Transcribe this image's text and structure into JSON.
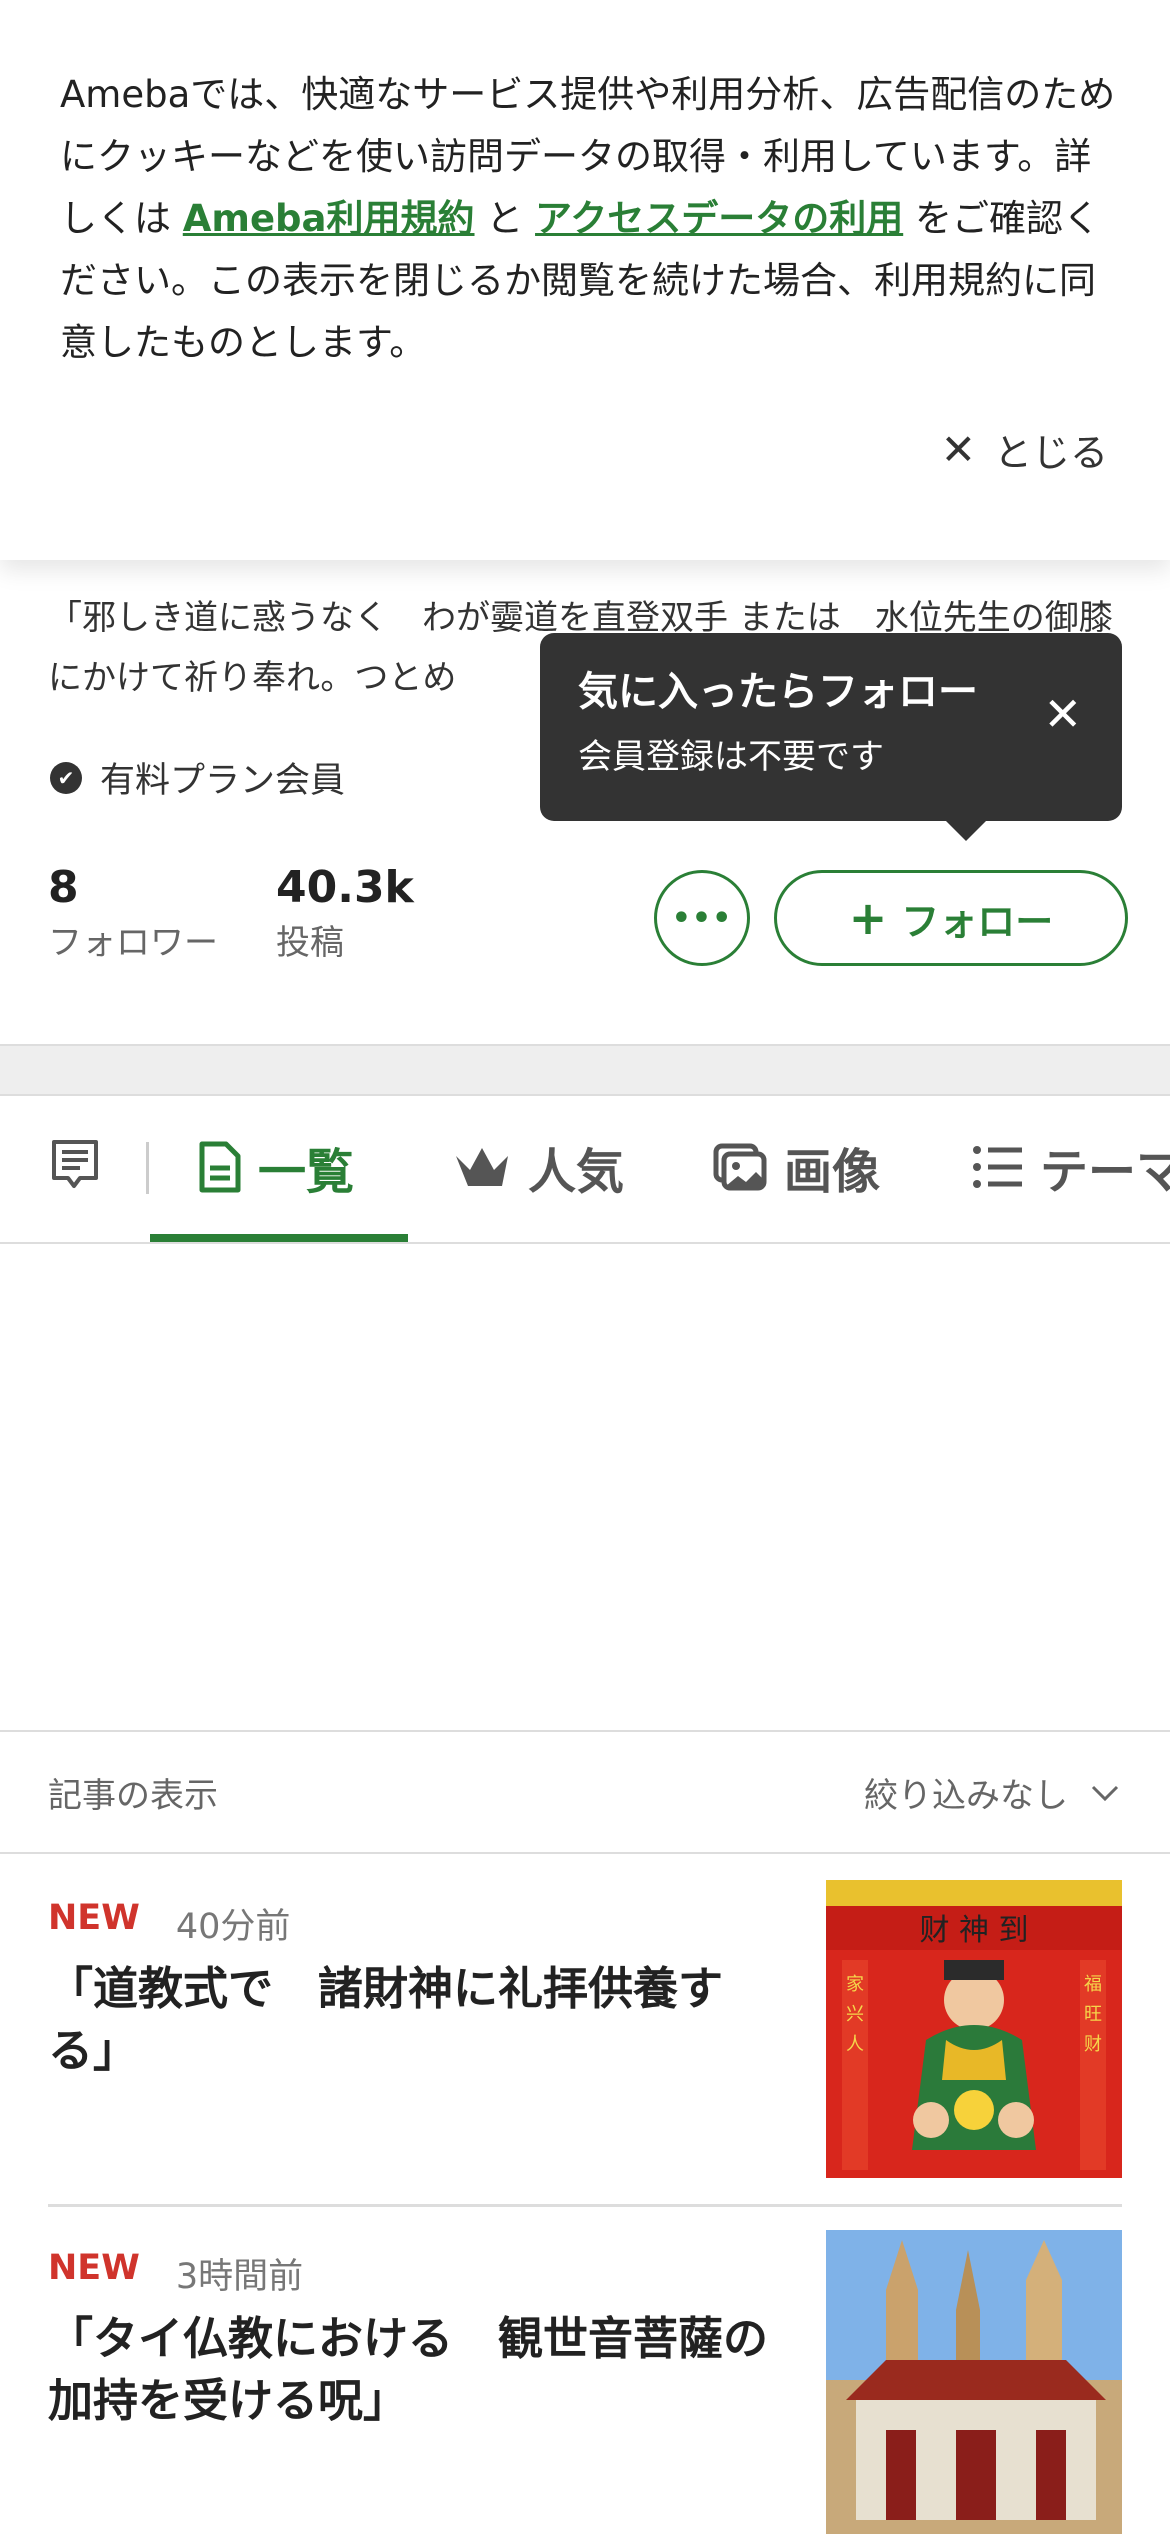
{
  "cookie": {
    "text_1": "Amebaでは、快適なサービス提供や利用分析、広告配信のためにクッキーなどを使い訪問データの取得・利用しています。詳しくは",
    "link_1": "Ameba利用規約",
    "text_2": "と",
    "link_2": "アクセスデータの利用",
    "text_3": "をご確認ください。この表示を閉じるか閲覧を続けた場合、利用規約に同意したものとします。",
    "close_label": "とじる"
  },
  "profile": {
    "description": "「邪しき道に惑うなく　わが孁道を直登双手 または　水位先生の御膝にかけて祈り奉れ。つとめ",
    "badge": "有料プラン会員",
    "followers": {
      "count": "8",
      "label": "フォロワー"
    },
    "posts": {
      "count": "40.3k",
      "label": "投稿"
    },
    "more_label": "•••",
    "follow_label": "フォロー"
  },
  "tooltip": {
    "title": "気に入ったらフォロー",
    "subtitle": "会員登録は不要です"
  },
  "tabs": [
    {
      "label": "一覧",
      "icon": "document-icon",
      "active": true
    },
    {
      "label": "人気",
      "icon": "crown-icon"
    },
    {
      "label": "画像",
      "icon": "images-icon"
    },
    {
      "label": "テーマ",
      "icon": "list-icon"
    }
  ],
  "filter": {
    "label": "記事の表示",
    "value": "絞り込みなし"
  },
  "articles": [
    {
      "badge": "NEW",
      "time": "40分前",
      "title": "「道教式で　諸財神に礼拝供養する」"
    },
    {
      "badge": "NEW",
      "time": "3時間前",
      "title": "「タイ仏教における　観世音菩薩の加持を受ける呪」"
    }
  ],
  "colors": {
    "accent": "#2a7f36",
    "new": "#d0342c",
    "tooltip_bg": "#333333"
  }
}
